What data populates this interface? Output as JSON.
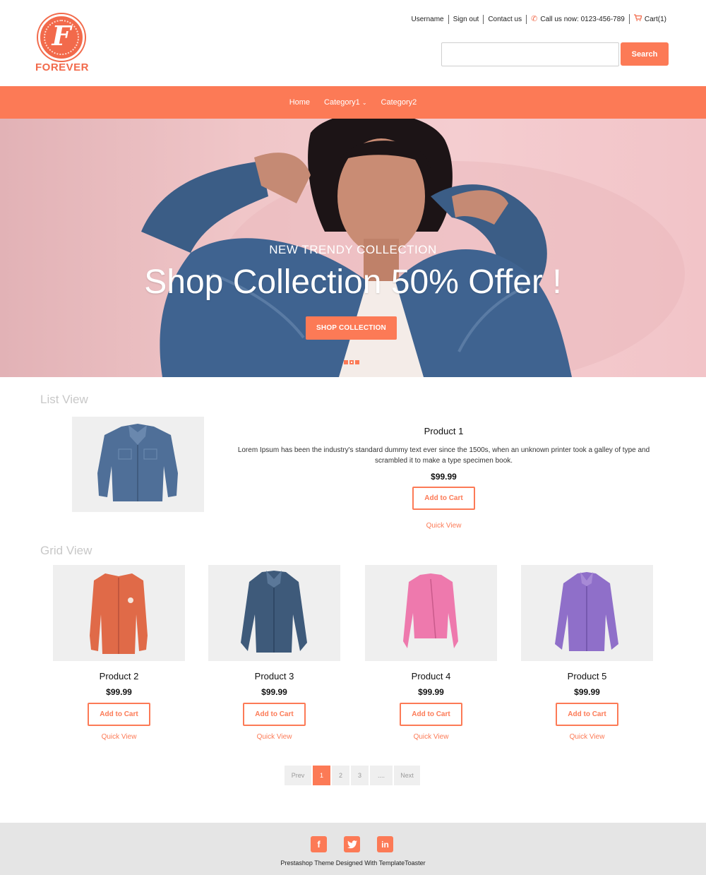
{
  "brand": {
    "logo_letter": "F",
    "name": "FOREVER",
    "accent": "#fc7a56"
  },
  "toplinks": {
    "username": "Username",
    "signout": "Sign out",
    "contact": "Contact us",
    "call": "Call us now: 0123-456-789",
    "cart": "Cart(1)",
    "call_icon": "phone-icon",
    "cart_icon": "cart-icon"
  },
  "search": {
    "value": "",
    "placeholder": "",
    "button": "Search"
  },
  "nav": {
    "home": "Home",
    "category1": "Category1",
    "category2": "Category2"
  },
  "hero": {
    "subtitle": "NEW TRENDY COLLECTION",
    "title": "Shop Collection 50% Offer !",
    "button": "SHOP COLLECTION",
    "slides": 3,
    "active_slide": 2
  },
  "list_view": {
    "heading": "List View",
    "product": {
      "name": "Product 1",
      "description": "Lorem Ipsum has been the industry's standard dummy text ever since the 1500s, when an unknown printer took a galley of type and scrambled it to make a type specimen book.",
      "price": "$99.99",
      "cart": "Add to Cart",
      "quick": "Quick View"
    }
  },
  "grid_view": {
    "heading": "Grid View",
    "products": [
      {
        "name": "Product 2",
        "price": "$99.99",
        "cart": "Add to Cart",
        "quick": "Quick View",
        "color": "#e06a48"
      },
      {
        "name": "Product 3",
        "price": "$99.99",
        "cart": "Add to Cart",
        "quick": "Quick View",
        "color": "#3e5a7a"
      },
      {
        "name": "Product 4",
        "price": "$99.99",
        "cart": "Add to Cart",
        "quick": "Quick View",
        "color": "#ee79ad"
      },
      {
        "name": "Product 5",
        "price": "$99.99",
        "cart": "Add to Cart",
        "quick": "Quick View",
        "color": "#8f6fc9"
      }
    ]
  },
  "pagination": {
    "prev": "Prev",
    "pages": [
      "1",
      "2",
      "3",
      "...."
    ],
    "next": "Next",
    "active": "1"
  },
  "footer": {
    "socials": [
      "facebook-icon",
      "twitter-icon",
      "linkedin-icon"
    ],
    "text": "Prestashop Theme Designed With TemplateToaster"
  }
}
